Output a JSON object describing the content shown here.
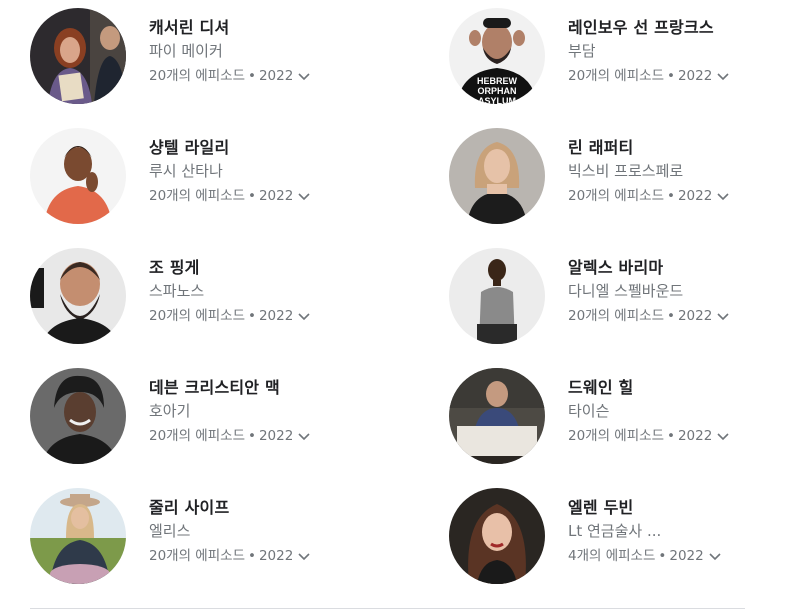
{
  "cast": [
    {
      "name": "캐서린 디셔",
      "role": "파이 메이커",
      "episodes": "20개의 에피소드",
      "year": "2022"
    },
    {
      "name": "레인보우 선 프랑크스",
      "role": "부담",
      "episodes": "20개의 에피소드",
      "year": "2022",
      "shirt_text": [
        "HEBREW",
        "ORPHAN",
        "ASYLUM"
      ]
    },
    {
      "name": "샹텔 라일리",
      "role": "루시 산타나",
      "episodes": "20개의 에피소드",
      "year": "2022"
    },
    {
      "name": "린 래퍼티",
      "role": "빅스비 프로스페로",
      "episodes": "20개의 에피소드",
      "year": "2022"
    },
    {
      "name": "조 핑게",
      "role": "스파노스",
      "episodes": "20개의 에피소드",
      "year": "2022"
    },
    {
      "name": "알렉스 바리마",
      "role": "다니엘 스펠바운드",
      "episodes": "20개의 에피소드",
      "year": "2022"
    },
    {
      "name": "데븐 크리스티안 맥",
      "role": "호아기",
      "episodes": "20개의 에피소드",
      "year": "2022"
    },
    {
      "name": "드웨인 힐",
      "role": "타이슨",
      "episodes": "20개의 에피소드",
      "year": "2022"
    },
    {
      "name": "줄리 사이프",
      "role": "엘리스",
      "episodes": "20개의 에피소드",
      "year": "2022"
    },
    {
      "name": "엘렌 두빈",
      "role": "Lt 연금술사 ...",
      "episodes": "4개의 에피소드",
      "year": "2022"
    }
  ],
  "separator": "•",
  "icons": {
    "expand": "chevron-down-icon"
  }
}
